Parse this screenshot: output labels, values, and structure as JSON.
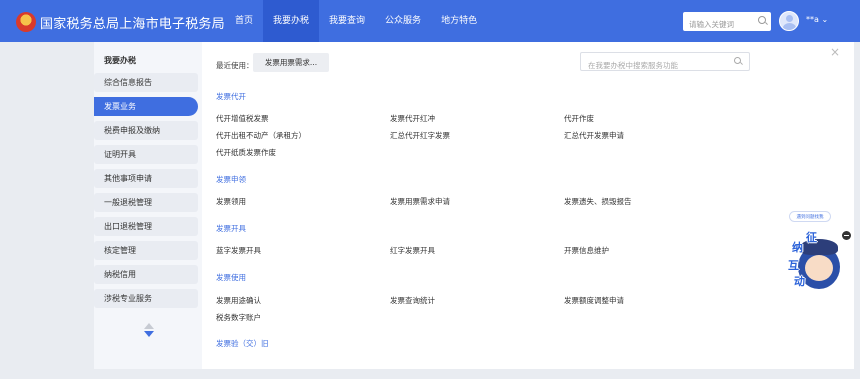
{
  "header": {
    "title": "国家税务总局上海市电子税务局",
    "nav": [
      "首页",
      "我要办税",
      "我要查询",
      "公众服务",
      "地方特色"
    ],
    "active_nav": "我要办税",
    "search_placeholder": "请输入关键词",
    "user_name": "**a ⌄"
  },
  "sidebar": {
    "title": "我要办税",
    "items": [
      "综合信息报告",
      "发票业务",
      "税费申报及缴纳",
      "证明开具",
      "其他事项申请",
      "一般退税管理",
      "出口退税管理",
      "核定管理",
      "纳税信用",
      "涉税专业服务"
    ],
    "active_item": "发票业务"
  },
  "main": {
    "recent_label": "最近使用：",
    "recent_items": [
      "发票用票需求..."
    ],
    "func_search_placeholder": "在我要办税中搜索服务功能",
    "close_label": "×",
    "sections": [
      {
        "title": "发票代开",
        "links": [
          "代开增值税发票",
          "发票代开红冲",
          "代开作废",
          "代开出租不动产（承租方）",
          "汇总代开红字发票",
          "汇总代开发票申请",
          "代开纸质发票作废"
        ]
      },
      {
        "title": "发票申领",
        "links": [
          "发票领用",
          "发票用票需求申请",
          "发票遗失、损毁报告"
        ]
      },
      {
        "title": "发票开具",
        "links": [
          "蓝字发票开具",
          "红字发票开具",
          "开票信息维护"
        ]
      },
      {
        "title": "发票使用",
        "links": [
          "发票用途确认",
          "发票查询统计",
          "发票额度调整申请",
          "税务数字账户"
        ]
      },
      {
        "title": "发票验（交）旧",
        "links": []
      }
    ]
  },
  "assistant": {
    "bubble": "遇到问题找我",
    "tags": [
      "征",
      "纳",
      "互",
      "动"
    ]
  },
  "colors": {
    "brand": "#3f6ee0",
    "sidebar_bg": "#f4f6fa",
    "page_bg": "#e9ecf1"
  },
  "icons": [
    "tax-bureau-logo",
    "search-icon",
    "user-avatar",
    "close-icon",
    "scroll-up-icon",
    "scroll-down-icon",
    "assistant-robot"
  ]
}
